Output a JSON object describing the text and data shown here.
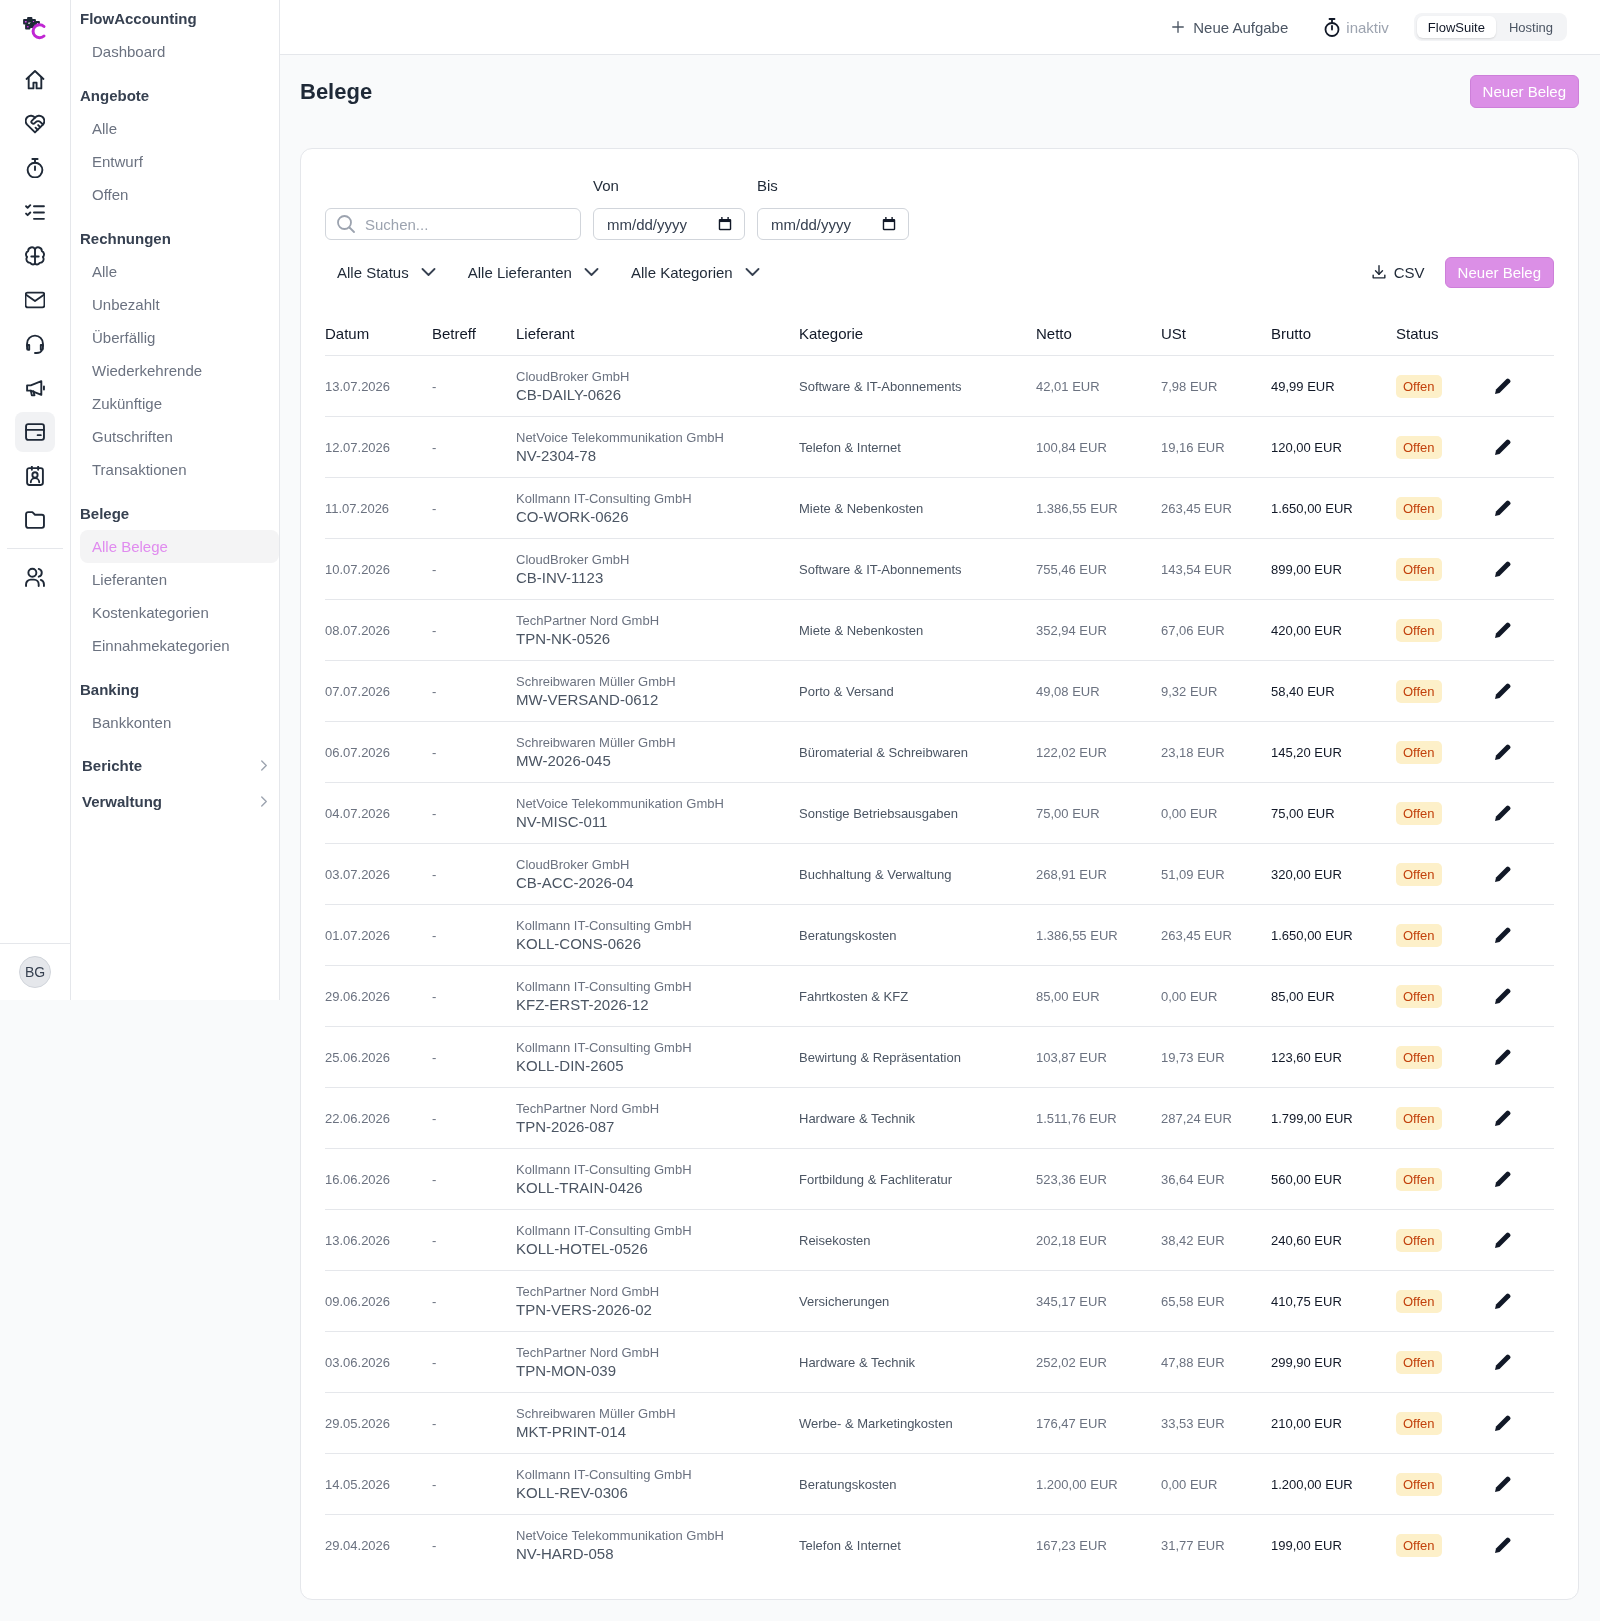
{
  "rail": {
    "main": [
      {
        "kind": "home",
        "selected": false
      },
      {
        "kind": "heart",
        "selected": false
      },
      {
        "kind": "stopwatch",
        "selected": false
      },
      {
        "kind": "checklist",
        "selected": false
      },
      {
        "kind": "brain",
        "selected": false
      },
      {
        "kind": "envelope",
        "selected": false
      },
      {
        "kind": "headset",
        "selected": false
      },
      {
        "kind": "megaphone",
        "selected": false
      },
      {
        "kind": "card",
        "selected": true
      },
      {
        "kind": "badge",
        "selected": false
      },
      {
        "kind": "folder",
        "selected": false
      }
    ],
    "secondary": [
      {
        "kind": "users",
        "selected": false
      }
    ],
    "avatar": {
      "initials": "BG"
    }
  },
  "sidebar": {
    "sections": [
      {
        "title": "FlowAccounting",
        "items": [
          {
            "label": "Dashboard",
            "selected": false
          }
        ]
      },
      {
        "title": "Angebote",
        "items": [
          {
            "label": "Alle",
            "selected": false
          },
          {
            "label": "Entwurf",
            "selected": false
          },
          {
            "label": "Offen",
            "selected": false
          }
        ]
      },
      {
        "title": "Rechnungen",
        "items": [
          {
            "label": "Alle",
            "selected": false
          },
          {
            "label": "Unbezahlt",
            "selected": false
          },
          {
            "label": "Überfällig",
            "selected": false
          },
          {
            "label": "Wiederkehrende",
            "selected": false
          },
          {
            "label": "Zukünftige",
            "selected": false
          },
          {
            "label": "Gutschriften",
            "selected": false
          },
          {
            "label": "Transaktionen",
            "selected": false
          }
        ]
      },
      {
        "title": "Belege",
        "items": [
          {
            "label": "Alle Belege",
            "selected": true
          },
          {
            "label": "Lieferanten",
            "selected": false
          },
          {
            "label": "Kostenkategorien",
            "selected": false
          },
          {
            "label": "Einnahmekategorien",
            "selected": false
          }
        ]
      },
      {
        "title": "Banking",
        "items": [
          {
            "label": "Bankkonten",
            "selected": false
          }
        ]
      }
    ],
    "groups": [
      {
        "label": "Berichte",
        "expanded": false
      },
      {
        "label": "Verwaltung",
        "expanded": false
      }
    ]
  },
  "topbar": {
    "new_task": "Neue Aufgabe",
    "timer": "inaktiv",
    "app_switch": [
      {
        "label": "FlowSuite",
        "selected": true
      },
      {
        "label": "Hosting",
        "selected": false
      }
    ]
  },
  "page": {
    "title": "Belege",
    "new_button": "Neuer Beleg"
  },
  "filters": {
    "search": {
      "placeholder": "Suchen..."
    },
    "date_from": {
      "label": "Von",
      "placeholder": "mm/dd/yyyy"
    },
    "date_to": {
      "label": "Bis",
      "placeholder": "mm/dd/yyyy"
    },
    "dropdowns": [
      "Alle Status",
      "Alle Lieferanten",
      "Alle Kategorien"
    ],
    "export_button": "CSV",
    "new_button": "Neuer Beleg"
  },
  "table": {
    "columns": [
      "Datum",
      "Betreff",
      "Lieferant",
      "Kategorie",
      "Netto",
      "USt",
      "Brutto",
      "Status"
    ],
    "rows": [
      {
        "date": "13.07.2026",
        "subject": "-",
        "supplier": "CloudBroker GmbH",
        "reference": "CB-DAILY-0626",
        "category": "Software & IT-Abonnements",
        "net": "42,01 EUR",
        "vat": "7,98 EUR",
        "gross": "49,99 EUR",
        "status": "Offen"
      },
      {
        "date": "12.07.2026",
        "subject": "-",
        "supplier": "NetVoice Telekommunikation GmbH",
        "reference": "NV-2304-78",
        "category": "Telefon & Internet",
        "net": "100,84 EUR",
        "vat": "19,16 EUR",
        "gross": "120,00 EUR",
        "status": "Offen"
      },
      {
        "date": "11.07.2026",
        "subject": "-",
        "supplier": "Kollmann IT-Consulting GmbH",
        "reference": "CO-WORK-0626",
        "category": "Miete & Nebenkosten",
        "net": "1.386,55 EUR",
        "vat": "263,45 EUR",
        "gross": "1.650,00 EUR",
        "status": "Offen"
      },
      {
        "date": "10.07.2026",
        "subject": "-",
        "supplier": "CloudBroker GmbH",
        "reference": "CB-INV-1123",
        "category": "Software & IT-Abonnements",
        "net": "755,46 EUR",
        "vat": "143,54 EUR",
        "gross": "899,00 EUR",
        "status": "Offen"
      },
      {
        "date": "08.07.2026",
        "subject": "-",
        "supplier": "TechPartner Nord GmbH",
        "reference": "TPN-NK-0526",
        "category": "Miete & Nebenkosten",
        "net": "352,94 EUR",
        "vat": "67,06 EUR",
        "gross": "420,00 EUR",
        "status": "Offen"
      },
      {
        "date": "07.07.2026",
        "subject": "-",
        "supplier": "Schreibwaren Müller GmbH",
        "reference": "MW-VERSAND-0612",
        "category": "Porto & Versand",
        "net": "49,08 EUR",
        "vat": "9,32 EUR",
        "gross": "58,40 EUR",
        "status": "Offen"
      },
      {
        "date": "06.07.2026",
        "subject": "-",
        "supplier": "Schreibwaren Müller GmbH",
        "reference": "MW-2026-045",
        "category": "Büromaterial & Schreibwaren",
        "net": "122,02 EUR",
        "vat": "23,18 EUR",
        "gross": "145,20 EUR",
        "status": "Offen"
      },
      {
        "date": "04.07.2026",
        "subject": "-",
        "supplier": "NetVoice Telekommunikation GmbH",
        "reference": "NV-MISC-011",
        "category": "Sonstige Betriebsausgaben",
        "net": "75,00 EUR",
        "vat": "0,00 EUR",
        "gross": "75,00 EUR",
        "status": "Offen"
      },
      {
        "date": "03.07.2026",
        "subject": "-",
        "supplier": "CloudBroker GmbH",
        "reference": "CB-ACC-2026-04",
        "category": "Buchhaltung & Verwaltung",
        "net": "268,91 EUR",
        "vat": "51,09 EUR",
        "gross": "320,00 EUR",
        "status": "Offen"
      },
      {
        "date": "01.07.2026",
        "subject": "-",
        "supplier": "Kollmann IT-Consulting GmbH",
        "reference": "KOLL-CONS-0626",
        "category": "Beratungskosten",
        "net": "1.386,55 EUR",
        "vat": "263,45 EUR",
        "gross": "1.650,00 EUR",
        "status": "Offen"
      },
      {
        "date": "29.06.2026",
        "subject": "-",
        "supplier": "Kollmann IT-Consulting GmbH",
        "reference": "KFZ-ERST-2026-12",
        "category": "Fahrtkosten & KFZ",
        "net": "85,00 EUR",
        "vat": "0,00 EUR",
        "gross": "85,00 EUR",
        "status": "Offen"
      },
      {
        "date": "25.06.2026",
        "subject": "-",
        "supplier": "Kollmann IT-Consulting GmbH",
        "reference": "KOLL-DIN-2605",
        "category": "Bewirtung & Repräsentation",
        "net": "103,87 EUR",
        "vat": "19,73 EUR",
        "gross": "123,60 EUR",
        "status": "Offen"
      },
      {
        "date": "22.06.2026",
        "subject": "-",
        "supplier": "TechPartner Nord GmbH",
        "reference": "TPN-2026-087",
        "category": "Hardware & Technik",
        "net": "1.511,76 EUR",
        "vat": "287,24 EUR",
        "gross": "1.799,00 EUR",
        "status": "Offen"
      },
      {
        "date": "16.06.2026",
        "subject": "-",
        "supplier": "Kollmann IT-Consulting GmbH",
        "reference": "KOLL-TRAIN-0426",
        "category": "Fortbildung & Fachliteratur",
        "net": "523,36 EUR",
        "vat": "36,64 EUR",
        "gross": "560,00 EUR",
        "status": "Offen"
      },
      {
        "date": "13.06.2026",
        "subject": "-",
        "supplier": "Kollmann IT-Consulting GmbH",
        "reference": "KOLL-HOTEL-0526",
        "category": "Reisekosten",
        "net": "202,18 EUR",
        "vat": "38,42 EUR",
        "gross": "240,60 EUR",
        "status": "Offen"
      },
      {
        "date": "09.06.2026",
        "subject": "-",
        "supplier": "TechPartner Nord GmbH",
        "reference": "TPN-VERS-2026-02",
        "category": "Versicherungen",
        "net": "345,17 EUR",
        "vat": "65,58 EUR",
        "gross": "410,75 EUR",
        "status": "Offen"
      },
      {
        "date": "03.06.2026",
        "subject": "-",
        "supplier": "TechPartner Nord GmbH",
        "reference": "TPN-MON-039",
        "category": "Hardware & Technik",
        "net": "252,02 EUR",
        "vat": "47,88 EUR",
        "gross": "299,90 EUR",
        "status": "Offen"
      },
      {
        "date": "29.05.2026",
        "subject": "-",
        "supplier": "Schreibwaren Müller GmbH",
        "reference": "MKT-PRINT-014",
        "category": "Werbe- & Marketingkosten",
        "net": "176,47 EUR",
        "vat": "33,53 EUR",
        "gross": "210,00 EUR",
        "status": "Offen"
      },
      {
        "date": "14.05.2026",
        "subject": "-",
        "supplier": "Kollmann IT-Consulting GmbH",
        "reference": "KOLL-REV-0306",
        "category": "Beratungskosten",
        "net": "1.200,00 EUR",
        "vat": "0,00 EUR",
        "gross": "1.200,00 EUR",
        "status": "Offen"
      },
      {
        "date": "29.04.2026",
        "subject": "-",
        "supplier": "NetVoice Telekommunikation GmbH",
        "reference": "NV-HARD-058",
        "category": "Telefon & Internet",
        "net": "167,23 EUR",
        "vat": "31,77 EUR",
        "gross": "199,00 EUR",
        "status": "Offen"
      }
    ]
  }
}
